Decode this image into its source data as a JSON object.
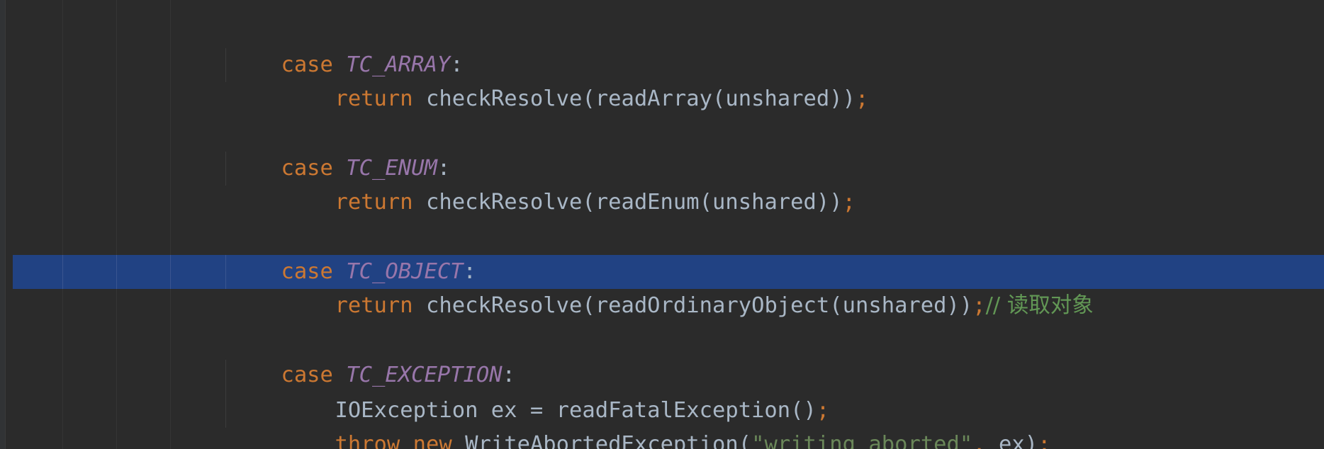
{
  "code": {
    "case1": {
      "kw": "case",
      "const": "TC_ARRAY",
      "colon": ":"
    },
    "ret1": {
      "kw": "return",
      "expr": "checkResolve(readArray(unshared))",
      "semi": ";"
    },
    "case2": {
      "kw": "case",
      "const": "TC_ENUM",
      "colon": ":"
    },
    "ret2": {
      "kw": "return",
      "expr": "checkResolve(readEnum(unshared))",
      "semi": ";"
    },
    "case3": {
      "kw": "case",
      "const": "TC_OBJECT",
      "colon": ":"
    },
    "ret3": {
      "kw": "return",
      "expr": "checkResolve(readOrdinaryObject(unshared))",
      "semi": ";",
      "comment": "// 读取对象"
    },
    "case4": {
      "kw": "case",
      "const": "TC_EXCEPTION",
      "colon": ":"
    },
    "stmt1": {
      "decl": "IOException ex = readFatalException()",
      "semi": ";"
    },
    "stmt2": {
      "kw1": "throw",
      "kw2": "new",
      "call": "WriteAbortedException(",
      "str": "\"writing aborted\"",
      "comma": ",",
      "arg": " ex)",
      "semi": ";"
    }
  }
}
